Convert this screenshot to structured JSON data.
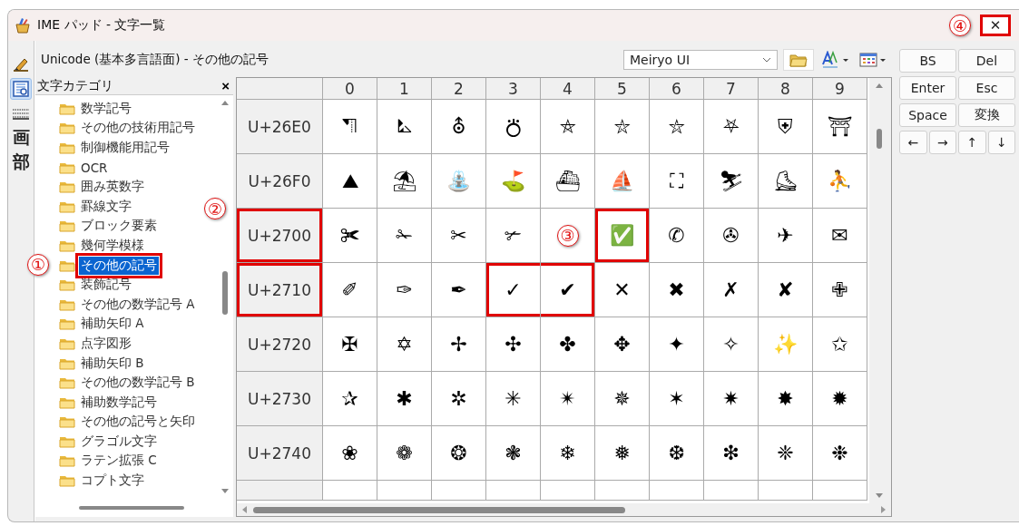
{
  "window": {
    "title": "IME パッド - 文字一覧",
    "close": {
      "label": "✕",
      "marked": true,
      "callout": "④"
    }
  },
  "mode_tabs": [
    {
      "kind": "handwriting",
      "selected": false
    },
    {
      "kind": "charlist",
      "selected": true
    },
    {
      "kind": "keyboard",
      "selected": false
    },
    {
      "kind": "glyph",
      "label": "画",
      "selected": false
    },
    {
      "kind": "glyph",
      "label": "部",
      "selected": false
    }
  ],
  "toolbar": {
    "title": "Unicode (基本多言語面) - その他の記号",
    "font": "Meiryo UI"
  },
  "category_panel": {
    "title": "文字カテゴリ",
    "close": "×",
    "items": [
      {
        "label": "数学記号",
        "selected": false
      },
      {
        "label": "その他の技術用記号",
        "selected": false
      },
      {
        "label": "制御機能用記号",
        "selected": false
      },
      {
        "label": "OCR",
        "selected": false
      },
      {
        "label": "囲み英数字",
        "selected": false
      },
      {
        "label": "罫線文字",
        "selected": false
      },
      {
        "label": "ブロック要素",
        "selected": false
      },
      {
        "label": "幾何学模様",
        "selected": false
      },
      {
        "label": "その他の記号",
        "selected": true,
        "marked": true,
        "callout": "①"
      },
      {
        "label": "装飾記号",
        "selected": false
      },
      {
        "label": "その他の数学記号 A",
        "selected": false
      },
      {
        "label": "補助矢印 A",
        "selected": false
      },
      {
        "label": "点字図形",
        "selected": false
      },
      {
        "label": "補助矢印 B",
        "selected": false
      },
      {
        "label": "その他の数学記号 B",
        "selected": false
      },
      {
        "label": "補助数学記号",
        "selected": false
      },
      {
        "label": "その他の記号と矢印",
        "selected": false
      },
      {
        "label": "グラゴル文字",
        "selected": false
      },
      {
        "label": "ラテン拡張 C",
        "selected": false
      },
      {
        "label": "コプト文字",
        "selected": false
      }
    ]
  },
  "grid": {
    "columns": [
      "0",
      "1",
      "2",
      "3",
      "4",
      "5",
      "6",
      "7",
      "8",
      "9"
    ],
    "rows": [
      {
        "code": "U+26E0",
        "marked": false,
        "cells": [
          {
            "char": "⛠"
          },
          {
            "char": "⛡"
          },
          {
            "char": "⛢"
          },
          {
            "char": "⛣"
          },
          {
            "char": "⛤"
          },
          {
            "char": "⛥"
          },
          {
            "char": "⛦"
          },
          {
            "char": "⛧"
          },
          {
            "char": "⛨"
          },
          {
            "char": "⛩"
          }
        ]
      },
      {
        "code": "U+26F0",
        "marked": false,
        "cells": [
          {
            "char": "⛰"
          },
          {
            "char": "⛱"
          },
          {
            "char": "⛲"
          },
          {
            "char": "⛳"
          },
          {
            "char": "⛴"
          },
          {
            "char": "⛵"
          },
          {
            "char": "⛶"
          },
          {
            "char": "⛷"
          },
          {
            "char": "⛸"
          },
          {
            "char": "⛹"
          }
        ]
      },
      {
        "code": "U+2700",
        "marked": true,
        "callout": "②",
        "cells": [
          {
            "char": "✀"
          },
          {
            "char": "✁"
          },
          {
            "char": "✂"
          },
          {
            "char": "✃"
          },
          {
            "callout": "③"
          },
          {
            "char": "✅",
            "marked": true
          },
          {
            "char": "✆"
          },
          {
            "char": "✇"
          },
          {
            "char": "✈"
          },
          {
            "char": "✉"
          }
        ]
      },
      {
        "code": "U+2710",
        "marked": true,
        "cells": [
          {
            "char": "✐"
          },
          {
            "char": "✑"
          },
          {
            "char": "✒"
          },
          {
            "char": "✓",
            "marked": true
          },
          {
            "char": "✔",
            "marked": true
          },
          {
            "char": "✕"
          },
          {
            "char": "✖"
          },
          {
            "char": "✗"
          },
          {
            "char": "✘"
          },
          {
            "char": "✙"
          }
        ]
      },
      {
        "code": "U+2720",
        "marked": false,
        "cells": [
          {
            "char": "✠"
          },
          {
            "char": "✡"
          },
          {
            "char": "✢"
          },
          {
            "char": "✣"
          },
          {
            "char": "✤"
          },
          {
            "char": "✥"
          },
          {
            "char": "✦"
          },
          {
            "char": "✧"
          },
          {
            "char": "✨"
          },
          {
            "char": "✩"
          }
        ]
      },
      {
        "code": "U+2730",
        "marked": false,
        "cells": [
          {
            "char": "✰"
          },
          {
            "char": "✱"
          },
          {
            "char": "✲"
          },
          {
            "char": "✳"
          },
          {
            "char": "✴"
          },
          {
            "char": "✵"
          },
          {
            "char": "✶"
          },
          {
            "char": "✷"
          },
          {
            "char": "✸"
          },
          {
            "char": "✹"
          }
        ]
      },
      {
        "code": "U+2740",
        "marked": false,
        "cells": [
          {
            "char": "❀"
          },
          {
            "char": "❁"
          },
          {
            "char": "❂"
          },
          {
            "char": "❃"
          },
          {
            "char": "❄"
          },
          {
            "char": "❅"
          },
          {
            "char": "❆"
          },
          {
            "char": "❇"
          },
          {
            "char": "❈"
          },
          {
            "char": "❉"
          }
        ]
      }
    ]
  },
  "keys": [
    {
      "label": "BS",
      "kind": "wide"
    },
    {
      "label": "Del",
      "kind": "wide"
    },
    {
      "label": "Enter",
      "kind": "wide"
    },
    {
      "label": "Esc",
      "kind": "wide"
    },
    {
      "label": "Space",
      "kind": "wide"
    },
    {
      "label": "変換",
      "kind": "wide"
    },
    {
      "label": "←",
      "kind": "arrow"
    },
    {
      "label": "→",
      "kind": "arrow"
    },
    {
      "label": "↑",
      "kind": "arrow"
    },
    {
      "label": "↓",
      "kind": "arrow"
    }
  ]
}
